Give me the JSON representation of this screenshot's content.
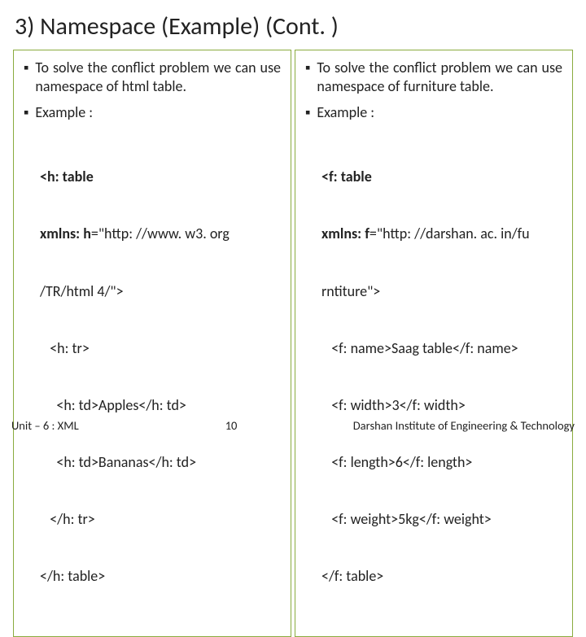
{
  "title": "3) Namespace (Example) (Cont. )",
  "left": {
    "bullet1": "To solve the conflict problem we can use namespace of html table.",
    "bullet2": "Example :",
    "code_open_bold": "<h: table",
    "code_ns_bold": "xmlns: h",
    "code_ns_rest": "=\"http: //www. w3. org",
    "code_line3": "/TR/html 4/\">",
    "code_line4": "   <h: tr>",
    "code_line5": "     <h: td>Apples</h: td>",
    "code_line6": "     <h: td>Bananas</h: td>",
    "code_line7": "   </h: tr>",
    "code_line8": "</h: table>"
  },
  "right": {
    "bullet1": "To solve the conflict problem we can use namespace of furniture table.",
    "bullet2": "Example :",
    "code_open_bold": "<f: table",
    "code_ns_bold": "xmlns: f",
    "code_ns_rest": "=\"http: //darshan. ac. in/fu",
    "code_line3": "rntiture\">",
    "code_line4": "   <f: name>Saag table</f: name>",
    "code_line5": "   <f: width>3</f: width>",
    "code_line6": "   <f: length>6</f: length>",
    "code_line7": "   <f: weight>5kg</f: weight>",
    "code_line8": "</f: table>"
  },
  "footer": {
    "left": "Unit – 6 : XML",
    "center": "10",
    "right": "Darshan Institute of Engineering & Technology"
  },
  "bullet_char": "▪"
}
